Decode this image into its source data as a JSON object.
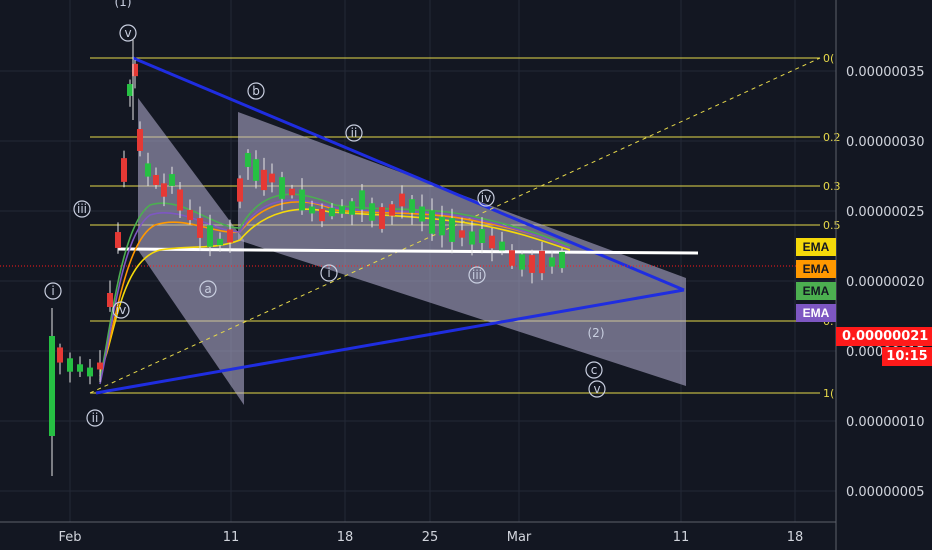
{
  "chart_data": {
    "type": "candlestick",
    "y_ticks": [
      "0.00000035",
      "0.00000030",
      "0.00000025",
      "0.00000020",
      "0.00000015",
      "0.00000010",
      "0.00000005"
    ],
    "x_ticks": [
      "Feb",
      "11",
      "18",
      "25",
      "Mar",
      "11",
      "18"
    ],
    "ylim": [
      3.5e-08,
      3.85e-07
    ],
    "grid": true,
    "current_price": "0.00000021",
    "countdown": "10:15",
    "indicators": [
      "EMA",
      "EMA",
      "EMA",
      "EMA"
    ],
    "ema_colors": [
      "#f5d90a",
      "#ff9800",
      "#4caf50",
      "#7e57c2"
    ],
    "fib_labels": [
      "0(",
      "0.2",
      "0.3",
      "0.5",
      "0.",
      "1("
    ],
    "wave_labels": [
      "(1)",
      "v",
      "iii",
      "i",
      "ii",
      "iv",
      "b",
      "ii",
      "iv",
      "a",
      "i",
      "iii",
      "(2)",
      "c",
      "v"
    ],
    "candles_approx": [
      {
        "date": "Jan 31",
        "low": 6e-08,
        "high": 1.75e-07
      },
      {
        "date": "Feb 3",
        "low": 1.15e-07,
        "high": 1.78e-07
      },
      {
        "date": "Feb 5",
        "low": 1.2e-07,
        "high": 3.65e-07
      },
      {
        "date": "Feb 11",
        "low": 2.05e-07,
        "high": 2.58e-07
      },
      {
        "date": "Feb 12",
        "low": 2.2e-07,
        "high": 3.2e-07
      },
      {
        "date": "Feb 20",
        "low": 2.25e-07,
        "high": 2.7e-07
      },
      {
        "date": "Feb 28",
        "low": 2e-07,
        "high": 2.3e-07
      },
      {
        "date": "Mar 4",
        "low": 2e-07,
        "high": 2.22e-07
      }
    ]
  },
  "colors": {
    "background": "#131722",
    "up_candle": "#26c043",
    "down_candle": "#e53935",
    "trend_line": "#1f2de0",
    "fib_line": "#e6d84a",
    "channel_fill": "#b8b2d6",
    "price_tag": "#ff1a1a"
  }
}
